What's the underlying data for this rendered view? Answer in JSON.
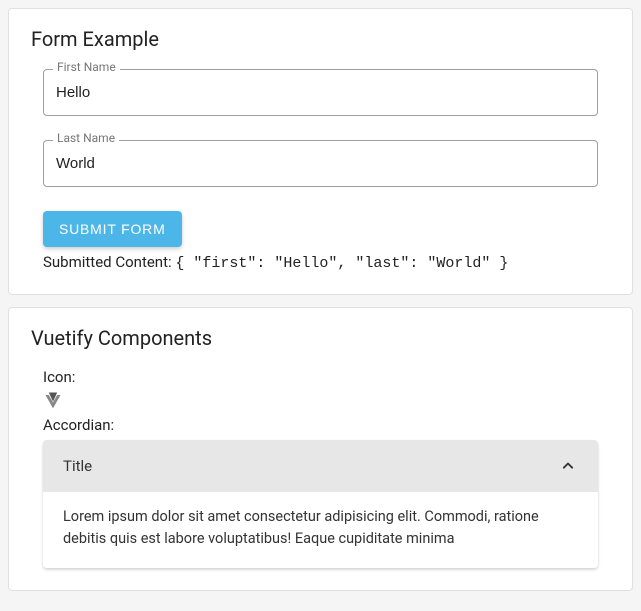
{
  "form": {
    "title": "Form Example",
    "first_label": "First Name",
    "first_value": "Hello",
    "last_label": "Last Name",
    "last_value": "World",
    "submit_label": "SUBMIT FORM",
    "submitted_label": "Submitted Content:",
    "submitted_value": "{ \"first\": \"Hello\", \"last\": \"World\" }"
  },
  "vuetify": {
    "title": "Vuetify Components",
    "icon_label": "Icon:",
    "accordion_label": "Accordian:",
    "accordion_title": "Title",
    "accordion_body": "Lorem ipsum dolor sit amet consectetur adipisicing elit. Commodi, ratione debitis quis est labore voluptatibus! Eaque cupiditate minima"
  }
}
